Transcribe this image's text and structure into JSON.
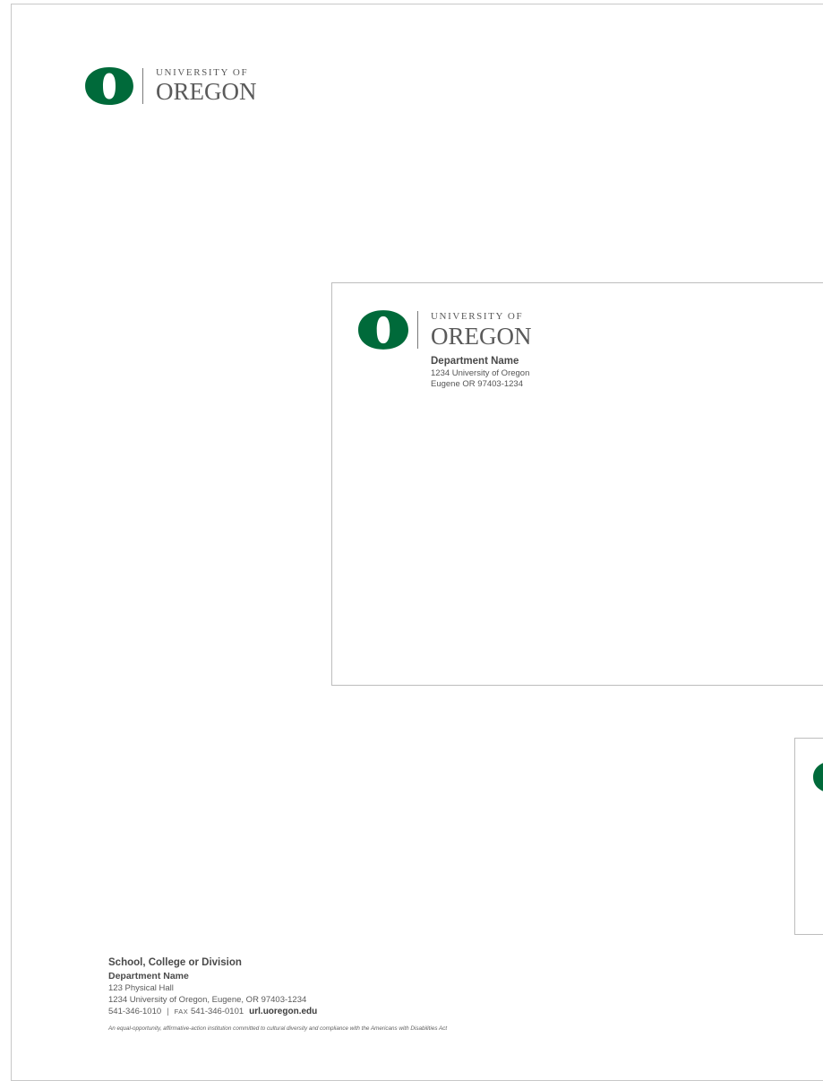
{
  "brand": {
    "green": "#006a3a",
    "logo_line1": "UNIVERSITY OF",
    "logo_line2": "OREGON",
    "logo_icon": "o-mark-icon"
  },
  "letterhead": {
    "school": "School, College or Division",
    "department": "Department Name",
    "building": "123 Physical Hall",
    "address": "1234 University of Oregon, Eugene, OR 97403-1234",
    "phone": "541-346-1010",
    "separator": "|",
    "fax_label": "FAX",
    "fax": "541-346-0101",
    "url": "url.uoregon.edu",
    "eeo_statement": "An equal-opportunity, affirmative-action institution committed to cultural diversity and compliance with the Americans with Disabilities Act"
  },
  "envelope": {
    "department": "Department Name",
    "address_line1": "1234 University of Oregon",
    "address_line2": "Eugene OR 97403-1234"
  }
}
